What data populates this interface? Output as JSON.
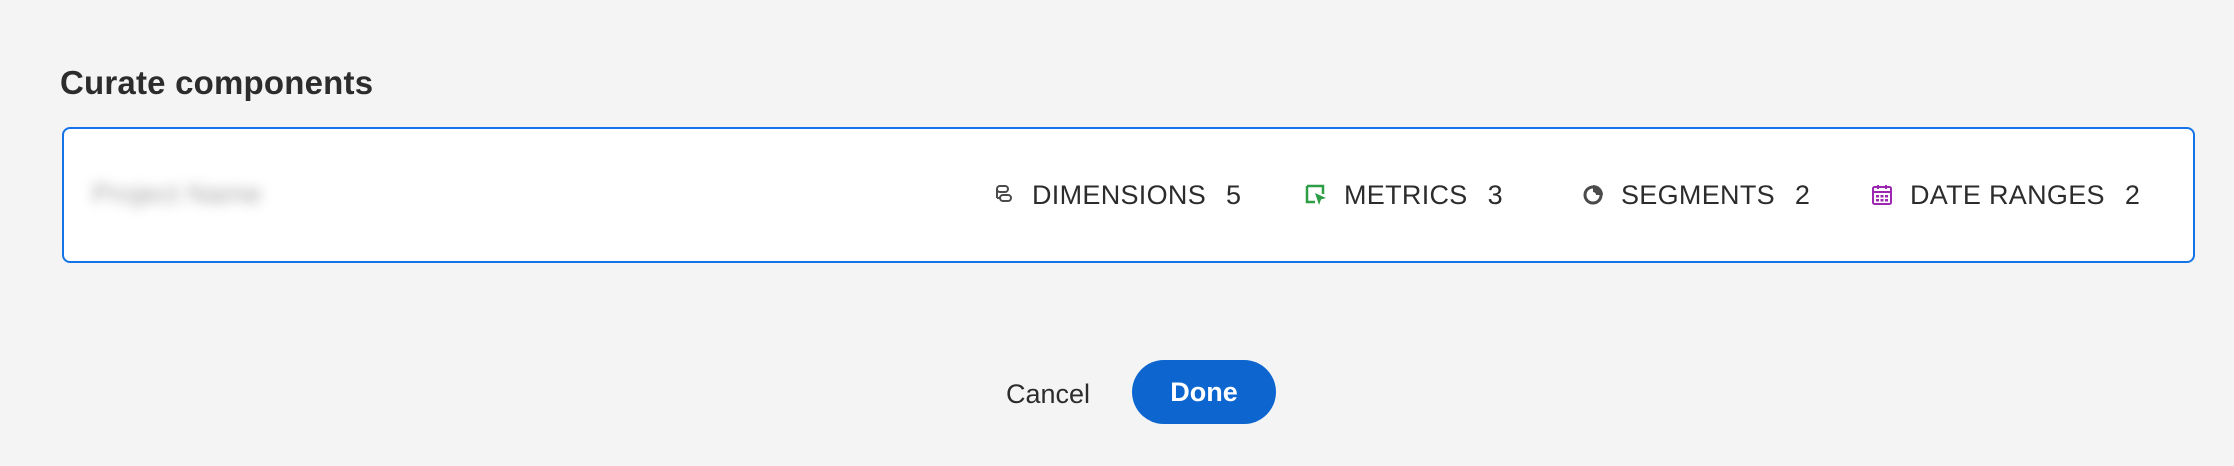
{
  "dialog": {
    "title": "Curate components"
  },
  "project_card": {
    "name_redacted": "Project Name",
    "stats": [
      {
        "icon": "dimensions-icon",
        "label": "DIMENSIONS",
        "count": "5",
        "color": "#4b4b4b"
      },
      {
        "icon": "metrics-icon",
        "label": "METRICS",
        "count": "3",
        "color": "#2d9d46"
      },
      {
        "icon": "segments-icon",
        "label": "SEGMENTS",
        "count": "2",
        "color": "#4b4b4b"
      },
      {
        "icon": "date-ranges-icon",
        "label": "DATE RANGES",
        "count": "2",
        "color": "#9c27b0"
      }
    ],
    "border_color": "#1473e6"
  },
  "footer": {
    "cancel_label": "Cancel",
    "done_label": "Done",
    "done_color": "#0d66d0"
  }
}
